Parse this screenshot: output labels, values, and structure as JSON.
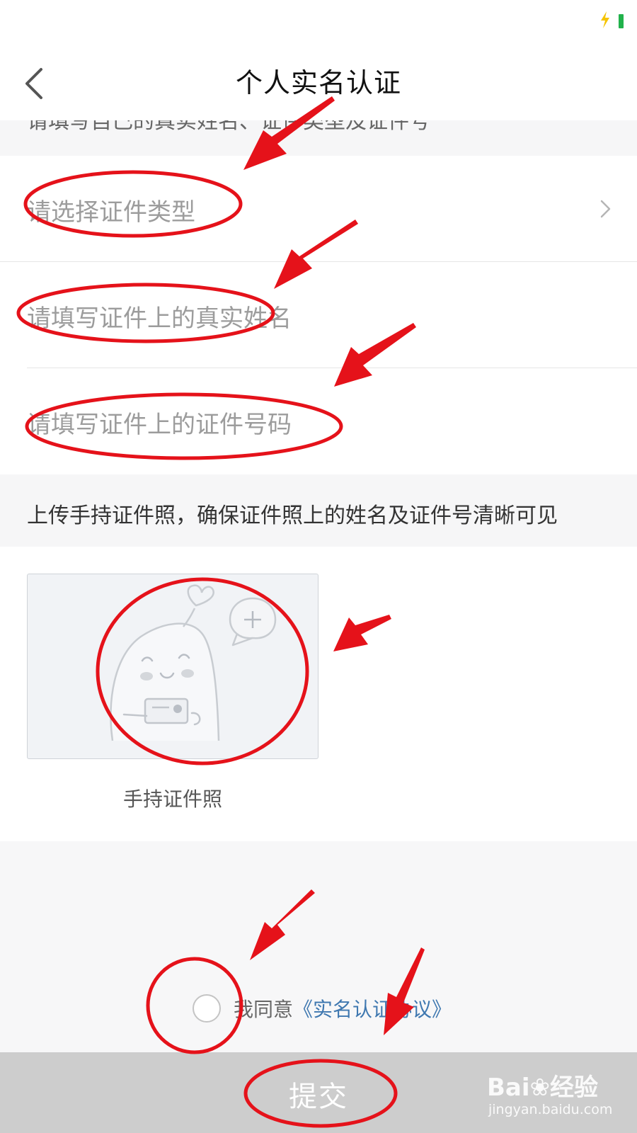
{
  "header": {
    "title": "个人实名认证"
  },
  "notice": "请填写自己的真实姓名、证件类型及证件号",
  "fields": [
    {
      "placeholder": "请选择证件类型"
    },
    {
      "placeholder": "请填写证件上的真实姓名"
    },
    {
      "placeholder": "请填写证件上的证件号码"
    }
  ],
  "upload": {
    "instruction": "上传手持证件照，确保证件照上的姓名及证件号清晰可见",
    "caption": "手持证件照"
  },
  "agreement": {
    "prefix": "我同意",
    "link": "《实名认证协议》"
  },
  "submit_label": "提交",
  "watermark": {
    "logo_left": "Bai",
    "logo_right": "经验",
    "url": "jingyan.baidu.com"
  },
  "colors": {
    "annotation": "#e5121a",
    "link": "#3f78b0",
    "battery": "#21b24b"
  },
  "icons": [
    "back-arrow-icon",
    "chevron-right-icon",
    "add-photo-icon",
    "charging-bolt-icon"
  ]
}
